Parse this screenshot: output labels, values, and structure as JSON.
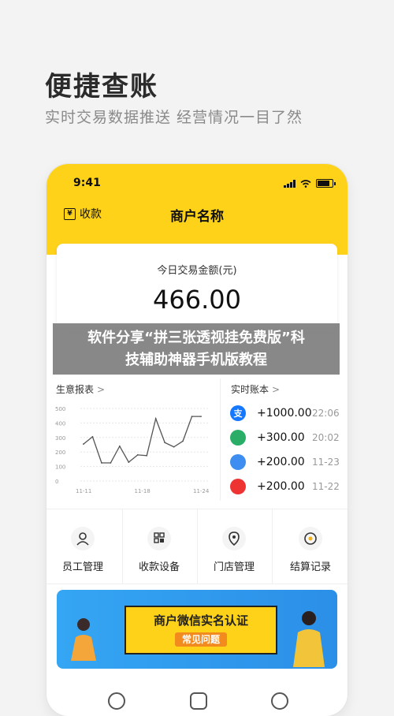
{
  "promo": {
    "headline": "便捷查账",
    "subline": "实时交易数据推送  经营情况一目了然"
  },
  "status_bar": {
    "time": "9:41"
  },
  "header": {
    "collect_label": "收款",
    "title": "商户名称"
  },
  "summary": {
    "label": "今日交易金额(元)",
    "amount": "466.00"
  },
  "overlay": {
    "line1": "软件分享“拼三张透视挂免费版”科",
    "line2": "技辅助神器手机版教程"
  },
  "report": {
    "title": "生意报表",
    "chevron": ">"
  },
  "chart_data": {
    "type": "line",
    "x_ticks": [
      "11-11",
      "11-18",
      "11-24"
    ],
    "y_ticks": [
      "0",
      "100",
      "200",
      "300",
      "400",
      "500"
    ],
    "ylim": [
      0,
      500
    ],
    "values": [
      255,
      305,
      125,
      125,
      240,
      130,
      180,
      175,
      430,
      265,
      235,
      275,
      445,
      445
    ],
    "color": "#555555"
  },
  "flow": {
    "title": "实时账本",
    "chevron": ">",
    "items": [
      {
        "icon": "alipay-icon",
        "glyph": "支",
        "color": "#1678ff",
        "amount": "+1000.00",
        "time": "22:06"
      },
      {
        "icon": "wechat-pay-icon",
        "glyph": "",
        "color": "#2aae67",
        "amount": "+300.00",
        "time": "20:02"
      },
      {
        "icon": "bank-card-icon",
        "glyph": "",
        "color": "#3d8ef0",
        "amount": "+200.00",
        "time": "11-23"
      },
      {
        "icon": "unionpay-icon",
        "glyph": "",
        "color": "#e33",
        "amount": "+200.00",
        "time": "11-22"
      }
    ]
  },
  "functions": [
    {
      "icon": "staff-icon",
      "label": "员工管理"
    },
    {
      "icon": "pos-device-icon",
      "label": "收款设备"
    },
    {
      "icon": "store-location-icon",
      "label": "门店管理"
    },
    {
      "icon": "settlement-icon",
      "label": "结算记录"
    }
  ],
  "banner": {
    "title": "商户微信实名认证",
    "subtitle": "常见问题"
  }
}
